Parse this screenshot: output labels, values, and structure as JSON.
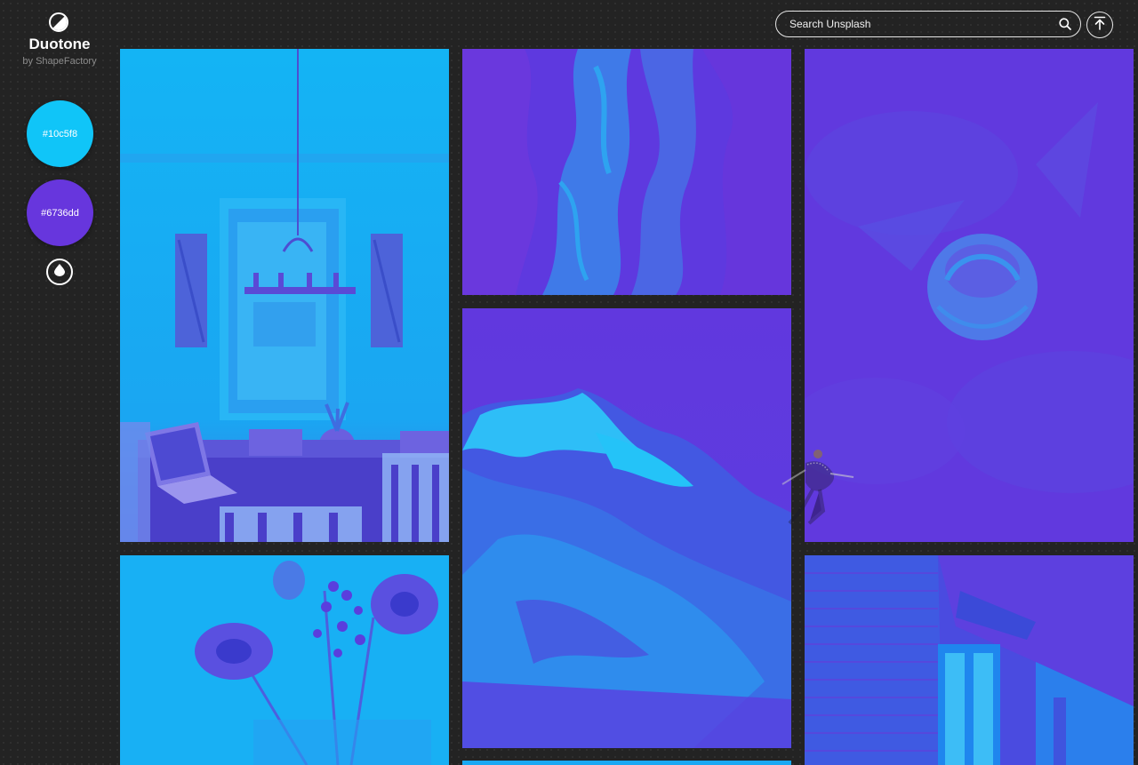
{
  "app": {
    "title": "Duotone",
    "subtitle": "by ShapeFactory"
  },
  "colors": {
    "light": "#10c5f8",
    "dark": "#6736dd"
  },
  "swatches": [
    {
      "label": "#10c5f8",
      "color": "#10c5f8"
    },
    {
      "label": "#6736dd",
      "color": "#6736dd"
    }
  ],
  "icons": {
    "logo": "half-circle-icon",
    "drop": "drop-icon",
    "search": "search-icon",
    "scroll_top": "arrow-up-to-line-icon"
  },
  "search": {
    "placeholder": "Search Unsplash",
    "value": ""
  },
  "photos": [
    {
      "subject": "dining-room"
    },
    {
      "subject": "canyon"
    },
    {
      "subject": "flower-bud"
    },
    {
      "subject": "coast-aerial"
    },
    {
      "subject": "bouquet"
    },
    {
      "subject": "brick-building"
    },
    {
      "subject": "partial"
    }
  ]
}
